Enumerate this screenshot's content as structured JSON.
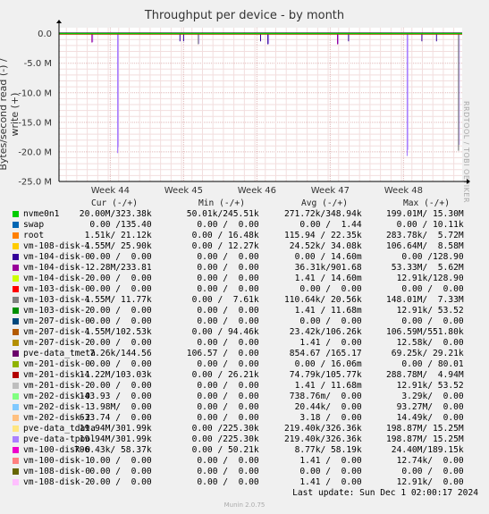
{
  "chart_data": {
    "type": "line",
    "title": "Throughput per device - by month",
    "ylabel": "Bytes/second read (-) / write (+)",
    "ylim": [
      -25000000,
      1000000
    ],
    "y_ticks": [
      "0.0",
      "-5.0 M",
      "-10.0 M",
      "-15.0 M",
      "-20.0 M",
      "-25.0 M"
    ],
    "x_ticks": [
      "Week 44",
      "Week 45",
      "Week 46",
      "Week 47",
      "Week 48"
    ],
    "grid": true,
    "spikes_negative": [
      {
        "week": 43.75,
        "value": -1500000
      },
      {
        "week": 44.1,
        "value": -20200000
      },
      {
        "week": 45.2,
        "value": -1800000
      },
      {
        "week": 46.15,
        "value": -1800000
      },
      {
        "week": 47.1,
        "value": -1800000
      },
      {
        "week": 48.05,
        "value": -20700000
      },
      {
        "week": 48.75,
        "value": -19800000
      }
    ]
  },
  "side_label": "RRDTOOL / TOBI OETIKER",
  "legend": {
    "headers": {
      "cur": "Cur (-/+)",
      "min": "Min (-/+)",
      "avg": "Avg (-/+)",
      "max": "Max (-/+)"
    },
    "rows": [
      {
        "name": "nvme0n1",
        "color": "#00cc00",
        "cur": "20.00M/323.38k",
        "min": "50.01k/245.51k",
        "avg": "271.72k/348.94k",
        "max": "199.01M/ 15.30M"
      },
      {
        "name": "swap",
        "color": "#0066b3",
        "cur": "0.00 /135.40",
        "min": "0.00 /  0.00",
        "avg": "0.00 /  1.44",
        "max": "0.00 / 10.11k"
      },
      {
        "name": "root",
        "color": "#ff8000",
        "cur": "1.51k/ 21.12k",
        "min": "0.00 / 16.48k",
        "avg": "115.94 / 22.35k",
        "max": "283.78k/  5.72M"
      },
      {
        "name": "vm-108-disk-1",
        "color": "#ffcc00",
        "cur": "4.55M/ 25.90k",
        "min": "0.00 / 12.27k",
        "avg": "24.52k/ 34.08k",
        "max": "106.64M/  8.58M"
      },
      {
        "name": "vm-104-disk-0",
        "color": "#330099",
        "cur": "0.00 /  0.00",
        "min": "0.00 /  0.00",
        "avg": "0.00 / 14.60m",
        "max": "0.00 /128.90"
      },
      {
        "name": "vm-104-disk-1",
        "color": "#990099",
        "cur": "2.28M/233.81",
        "min": "0.00 /  0.00",
        "avg": "36.31k/901.68",
        "max": "53.33M/  5.62M"
      },
      {
        "name": "vm-104-disk-2",
        "color": "#ccff00",
        "cur": "0.00 /  0.00",
        "min": "0.00 /  0.00",
        "avg": "1.41 / 14.60m",
        "max": "12.91k/128.90"
      },
      {
        "name": "vm-103-disk-0",
        "color": "#ff0000",
        "cur": "0.00 /  0.00",
        "min": "0.00 /  0.00",
        "avg": "0.00 /  0.00",
        "max": "0.00 /  0.00"
      },
      {
        "name": "vm-103-disk-1",
        "color": "#808080",
        "cur": "4.55M/ 11.77k",
        "min": "0.00 /  7.61k",
        "avg": "110.64k/ 20.56k",
        "max": "148.01M/  7.33M"
      },
      {
        "name": "vm-103-disk-2",
        "color": "#008f00",
        "cur": "0.00 /  0.00",
        "min": "0.00 /  0.00",
        "avg": "1.41 / 11.68m",
        "max": "12.91k/ 53.52"
      },
      {
        "name": "vm-207-disk-0",
        "color": "#00487d",
        "cur": "0.00 /  0.00",
        "min": "0.00 /  0.00",
        "avg": "0.00 /  0.00",
        "max": "0.00 /  0.00"
      },
      {
        "name": "vm-207-disk-1",
        "color": "#b35a00",
        "cur": "4.55M/102.53k",
        "min": "0.00 / 94.46k",
        "avg": "23.42k/106.26k",
        "max": "106.59M/551.80k"
      },
      {
        "name": "vm-207-disk-2",
        "color": "#b38f00",
        "cur": "0.00 /  0.00",
        "min": "0.00 /  0.00",
        "avg": "1.41 /  0.00",
        "max": "12.58k/  0.00"
      },
      {
        "name": "pve-data_tmeta",
        "color": "#6b006b",
        "cur": "7.26k/144.56",
        "min": "106.57 /  0.00",
        "avg": "854.67 /165.17",
        "max": "69.25k/ 29.21k"
      },
      {
        "name": "vm-201-disk-0",
        "color": "#8fb300",
        "cur": "0.00 /  0.00",
        "min": "0.00 /  0.00",
        "avg": "0.00 / 16.06m",
        "max": "0.00 / 80.01"
      },
      {
        "name": "vm-201-disk-1",
        "color": "#b30000",
        "cur": "14.22M/103.03k",
        "min": "0.00 / 26.21k",
        "avg": "74.79k/105.77k",
        "max": "288.78M/  4.94M"
      },
      {
        "name": "vm-201-disk-2",
        "color": "#bebebe",
        "cur": "0.00 /  0.00",
        "min": "0.00 /  0.00",
        "avg": "1.41 / 11.68m",
        "max": "12.91k/ 53.52"
      },
      {
        "name": "vm-202-disk-0",
        "color": "#80ff80",
        "cur": "143.93 /  0.00",
        "min": "0.00 /  0.00",
        "avg": "738.76m/  0.00",
        "max": "3.29k/  0.00"
      },
      {
        "name": "vm-202-disk-1",
        "color": "#80c9ff",
        "cur": "3.98M/  0.00",
        "min": "0.00 /  0.00",
        "avg": "20.44k/  0.00",
        "max": "93.27M/  0.00"
      },
      {
        "name": "vm-202-disk-2",
        "color": "#ffc080",
        "cur": "633.74 /  0.00",
        "min": "0.00 /  0.00",
        "avg": "3.18 /  0.00",
        "max": "14.49k/  0.00"
      },
      {
        "name": "pve-data_tdata",
        "color": "#ffe680",
        "cur": "19.94M/301.99k",
        "min": "0.00 /225.30k",
        "avg": "219.40k/326.36k",
        "max": "198.87M/ 15.25M"
      },
      {
        "name": "pve-data-tpool",
        "color": "#aa80ff",
        "cur": "19.94M/301.99k",
        "min": "0.00 /225.30k",
        "avg": "219.40k/326.36k",
        "max": "198.87M/ 15.25M"
      },
      {
        "name": "vm-100-disk-0",
        "color": "#ee00cc",
        "cur": "706.43k/ 58.37k",
        "min": "0.00 / 50.21k",
        "avg": "8.77k/ 58.19k",
        "max": "24.40M/189.15k"
      },
      {
        "name": "vm-100-disk-1",
        "color": "#ff8080",
        "cur": "0.00 /  0.00",
        "min": "0.00 /  0.00",
        "avg": "1.41 /  0.00",
        "max": "12.74k/  0.00"
      },
      {
        "name": "vm-108-disk-0",
        "color": "#666600",
        "cur": "0.00 /  0.00",
        "min": "0.00 /  0.00",
        "avg": "0.00 /  0.00",
        "max": "0.00 /  0.00"
      },
      {
        "name": "vm-108-disk-2",
        "color": "#ffbfff",
        "cur": "0.00 /  0.00",
        "min": "0.00 /  0.00",
        "avg": "1.41 /  0.00",
        "max": "12.91k/  0.00"
      }
    ]
  },
  "footer": "Last update: Sun Dec  1 02:00:17 2024",
  "version": "Munin 2.0.75"
}
